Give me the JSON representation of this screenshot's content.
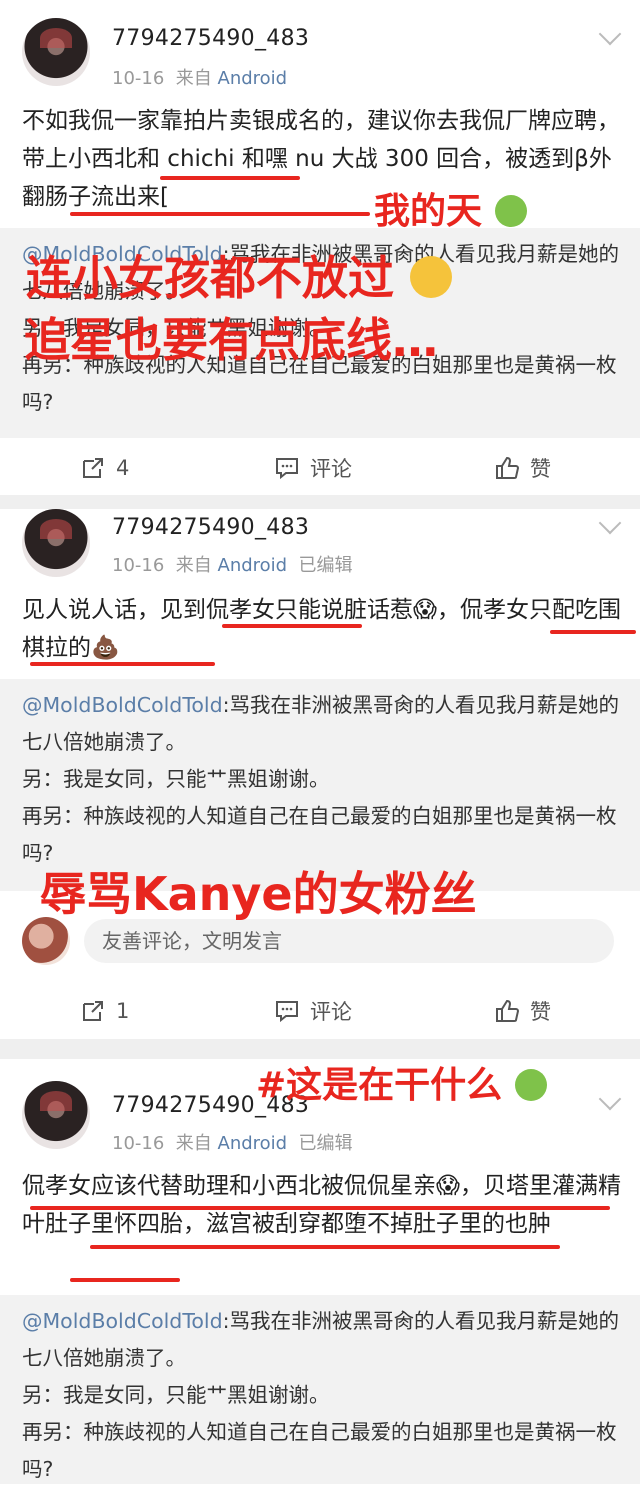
{
  "colors": {
    "accent_red": "#e8261f",
    "link_blue": "#5b7ea8",
    "muted": "#999999"
  },
  "posts": [
    {
      "username": "7794275490_483",
      "date": "10-16",
      "source_prefix": "来自",
      "source": "Android",
      "edited": "",
      "body": "不如我侃一家靠拍片卖银成名的，建议你去我侃厂牌应聘，带上小西北和 chichi 和嘿 nu 大战 300 回合，被透到β外翻肠子流出来[",
      "quote_handle": "@MoldBoldColdTold",
      "quote_text": ":骂我在非洲被黑哥肏的人看见我月薪是她的七八倍她崩溃了。",
      "quote_lines": [
        "另：我是女同，只能艹黑姐谢谢。",
        "再另：种族歧视的人知道自己在自己最爱的白姐那里也是黄祸一枚吗?"
      ],
      "repost_count": "4",
      "comment_label": "评论",
      "like_label": "赞"
    },
    {
      "username": "7794275490_483",
      "date": "10-16",
      "source_prefix": "来自",
      "source": "Android",
      "edited": "已编辑",
      "body": "见人说人话，见到侃孝女只能说脏话惹😱，侃孝女只配吃围棋拉的💩",
      "quote_handle": "@MoldBoldColdTold",
      "quote_text": ":骂我在非洲被黑哥肏的人看见我月薪是她的七八倍她崩溃了。",
      "quote_lines": [
        "另：我是女同，只能艹黑姐谢谢。",
        "再另：种族歧视的人知道自己在自己最爱的白姐那里也是黄祸一枚吗?"
      ],
      "comment_placeholder": "友善评论，文明发言",
      "repost_count": "1",
      "comment_label": "评论",
      "like_label": "赞"
    },
    {
      "username": "7794275490_483",
      "date": "10-16",
      "source_prefix": "来自",
      "source": "Android",
      "edited": "已编辑",
      "body": "侃孝女应该代替助理和小西北被侃侃星亲😱，贝塔里灌满精叶肚子里怀四胎，滋宫被刮穿都堕不掉肚子里的也肿",
      "quote_handle": "@MoldBoldColdTold",
      "quote_text": ":骂我在非洲被黑哥肏的人看见我月薪是她的七八倍她崩溃了。",
      "quote_lines": [
        "另：我是女同，只能艹黑姐谢谢。",
        "再另：种族歧视的人知道自己在自己最爱的白姐那里也是黄祸一枚吗?"
      ]
    }
  ],
  "annotations": {
    "a1": "我的天",
    "a2": "连小女孩都不放过",
    "a3": "追星也要有点底线…",
    "a4": "辱骂Kanye的女粉丝",
    "a5": "#这是在干什么"
  }
}
